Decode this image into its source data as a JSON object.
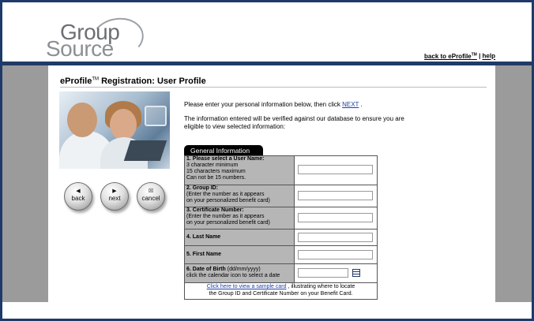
{
  "brand": {
    "word1": "Group",
    "word2": "Source"
  },
  "top_links": {
    "back": "back to eProfile",
    "tm": "TM",
    "sep": " | ",
    "help": "help"
  },
  "page": {
    "title_pre": "eProfile",
    "title_tm": "TM",
    "title_post": " Registration: User Profile"
  },
  "intro": {
    "line1_pre": "Please enter your personal information below, then click  ",
    "line1_link": "NEXT",
    "line1_post": " .",
    "line2": "The information entered will be verified against our database to ensure you are eligible to view selected information:"
  },
  "nav": {
    "back_icon": "◀",
    "back_label": "back",
    "next_icon": "▶",
    "next_label": "next",
    "cancel_icon": "☒",
    "cancel_label": "cancel"
  },
  "form": {
    "tab_label": "General Information",
    "fields": [
      {
        "title": "1. Please select a User Name:",
        "sub": [
          "3 character minimum",
          "15 characters maximum",
          "Can not be 15 numbers."
        ],
        "value": ""
      },
      {
        "title": "2. Group ID:",
        "sub": [
          "(Enter the number as it appears",
          "on your personalized benefit card)"
        ],
        "value": ""
      },
      {
        "title": "3. Certificate Number:",
        "sub": [
          "(Enter the number as it appears",
          "on your personalized benefit card)"
        ],
        "value": ""
      },
      {
        "title": "4. Last Name",
        "sub": [],
        "value": ""
      },
      {
        "title": "5. First Name",
        "sub": [],
        "value": ""
      },
      {
        "title": "6. Date of Birth",
        "title_suffix": " (dd/mm/yyyy)",
        "sub": [
          "click the calendar icon to select a date"
        ],
        "value": ""
      }
    ],
    "footer_link": "Click here to view a sample card",
    "footer_text1": " , illustrating where to locate",
    "footer_text2": "the Group ID and Certificate Number on your Benefit Card."
  },
  "icons": {
    "calendar": "calendar-icon",
    "photo": "couple-laptop-photo",
    "lock": "lock-icon"
  },
  "colors": {
    "frame": "#1d3a6a",
    "bar": "#223a65",
    "gray": "#9b9b9b",
    "label_bg": "#b6b6b6",
    "link": "#2142a8"
  }
}
